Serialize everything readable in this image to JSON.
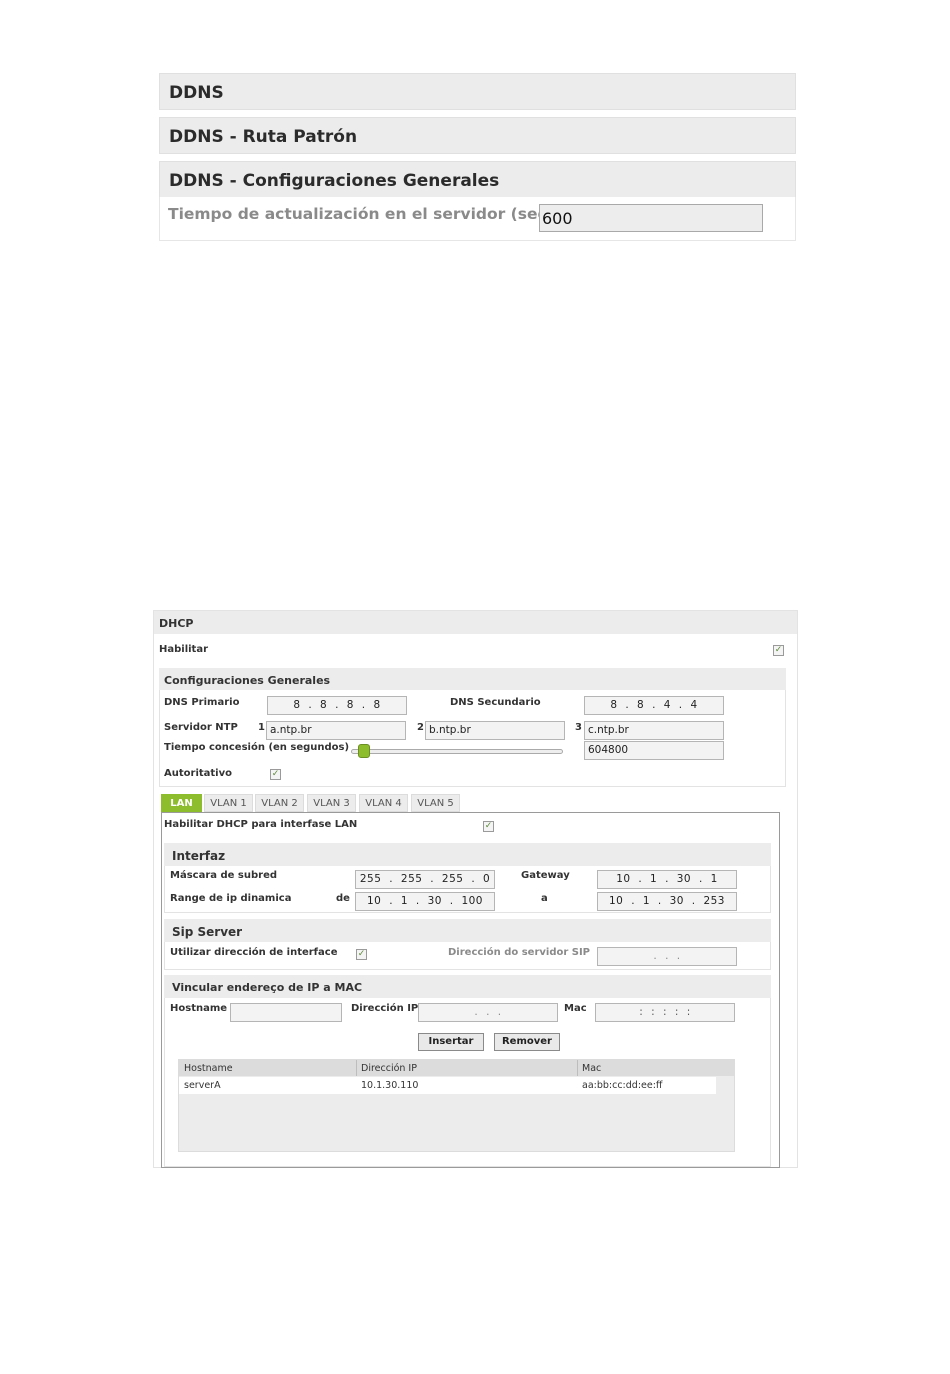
{
  "ddns": {
    "title": "DDNS",
    "ruta_title": "DDNS - Ruta Patrón",
    "config_title": "DDNS - Configuraciones Generales",
    "update_time_label": "Tiempo de actualización en el servidor (seg)",
    "update_time_value": "600"
  },
  "dhcp": {
    "title": "DHCP",
    "enable_label": "Habilitar",
    "enable_checked": true,
    "general": {
      "title": "Configuraciones Generales",
      "dns_primary_label": "DNS Primario",
      "dns_primary_value": "8 . 8 . 8 . 8",
      "dns_secondary_label": "DNS Secundario",
      "dns_secondary_value": "8 . 8 . 4 . 4",
      "ntp_label": "Servidor NTP",
      "ntp": [
        {
          "index": "1",
          "value": "a.ntp.br"
        },
        {
          "index": "2",
          "value": "b.ntp.br"
        },
        {
          "index": "3",
          "value": "c.ntp.br"
        }
      ],
      "lease_label": "Tiempo concesión (en segundos)",
      "lease_value": "604800",
      "lease_slider_fraction": 0.05,
      "authoritative_label": "Autoritativo",
      "authoritative_checked": true
    },
    "tabs": [
      "LAN",
      "VLAN 1",
      "VLAN 2",
      "VLAN 3",
      "VLAN 4",
      "VLAN 5"
    ],
    "active_tab": "LAN",
    "lan": {
      "enable_label": "Habilitar DHCP para interfase LAN",
      "enable_checked": true,
      "interface": {
        "title": "Interfaz",
        "mask_label": "Máscara de subred",
        "mask_value": "255 . 255 . 255 . 0",
        "gateway_label": "Gateway",
        "gateway_value": "10 . 1 . 30 . 1",
        "range_label": "Range de ip dinamica",
        "from_label": "de",
        "from_value": "10 . 1 . 30 . 100",
        "to_label": "a",
        "to_value": "10 . 1 . 30 . 253"
      },
      "sip": {
        "title": "Sip Server",
        "use_iface_label": "Utilizar dirección de interface",
        "use_iface_checked": true,
        "sip_addr_label": "Dirección do servidor SIP",
        "sip_addr_value": ". . ."
      },
      "bind": {
        "title": "Vincular endereço de IP a MAC",
        "hostname_label": "Hostname",
        "ip_label": "Dirección IP",
        "ip_placeholder": ". . .",
        "mac_label": "Mac",
        "mac_placeholder": ": : : : :",
        "insert_label": "Insertar",
        "remove_label": "Remover",
        "columns": [
          "Hostname",
          "Dirección IP",
          "Mac"
        ],
        "rows": [
          {
            "hostname": "serverA",
            "ip": "10.1.30.110",
            "mac": "aa:bb:cc:dd:ee:ff"
          }
        ]
      }
    }
  },
  "colors": {
    "accent": "#8dbd2c",
    "header_bg": "#ececec",
    "label_gray": "#8a8a8a"
  }
}
